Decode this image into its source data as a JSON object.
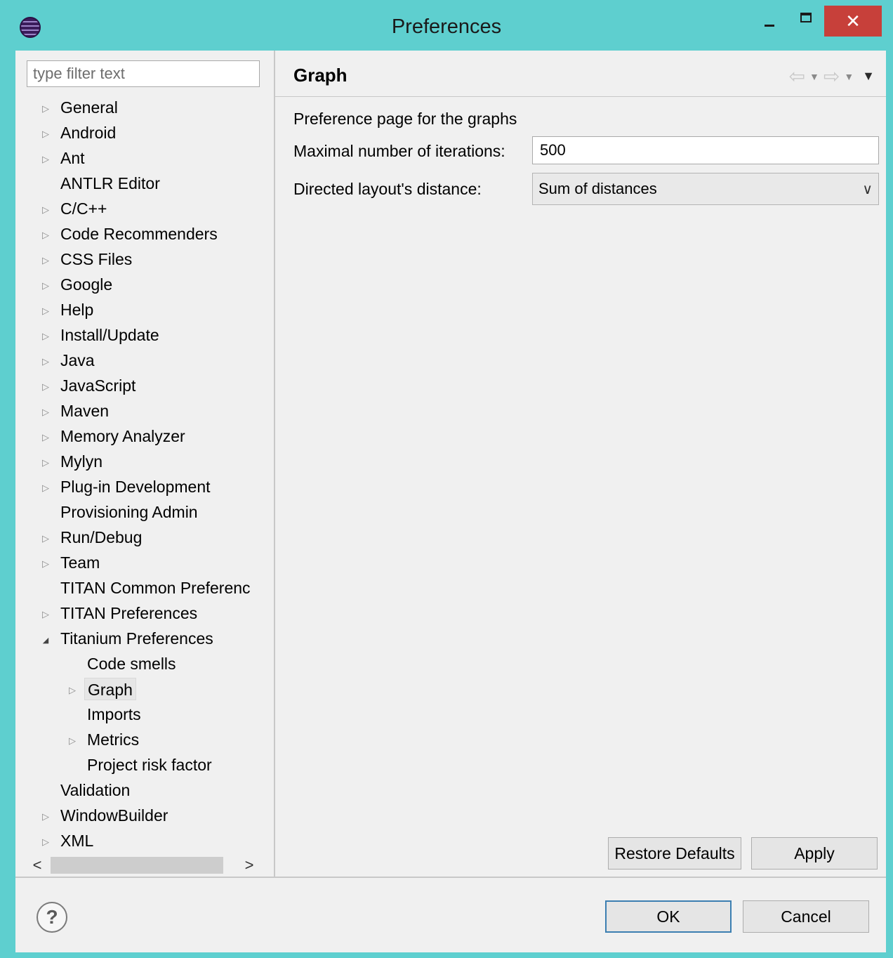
{
  "window": {
    "title": "Preferences",
    "minimize_glyph": "–",
    "maximize_glyph": "□",
    "close_glyph": "✕",
    "app_icon": "eclipse-icon"
  },
  "sidebar": {
    "filter_placeholder": "type filter text",
    "items": [
      {
        "label": "General",
        "expandable": true,
        "expanded": false,
        "level": 0
      },
      {
        "label": "Android",
        "expandable": true,
        "expanded": false,
        "level": 0
      },
      {
        "label": "Ant",
        "expandable": true,
        "expanded": false,
        "level": 0
      },
      {
        "label": "ANTLR Editor",
        "expandable": false,
        "level": 0
      },
      {
        "label": "C/C++",
        "expandable": true,
        "expanded": false,
        "level": 0
      },
      {
        "label": "Code Recommenders",
        "expandable": true,
        "expanded": false,
        "level": 0
      },
      {
        "label": "CSS Files",
        "expandable": true,
        "expanded": false,
        "level": 0
      },
      {
        "label": "Google",
        "expandable": true,
        "expanded": false,
        "level": 0
      },
      {
        "label": "Help",
        "expandable": true,
        "expanded": false,
        "level": 0
      },
      {
        "label": "Install/Update",
        "expandable": true,
        "expanded": false,
        "level": 0
      },
      {
        "label": "Java",
        "expandable": true,
        "expanded": false,
        "level": 0
      },
      {
        "label": "JavaScript",
        "expandable": true,
        "expanded": false,
        "level": 0
      },
      {
        "label": "Maven",
        "expandable": true,
        "expanded": false,
        "level": 0
      },
      {
        "label": "Memory Analyzer",
        "expandable": true,
        "expanded": false,
        "level": 0
      },
      {
        "label": "Mylyn",
        "expandable": true,
        "expanded": false,
        "level": 0
      },
      {
        "label": "Plug-in Development",
        "expandable": true,
        "expanded": false,
        "level": 0
      },
      {
        "label": "Provisioning Admin",
        "expandable": false,
        "level": 0
      },
      {
        "label": "Run/Debug",
        "expandable": true,
        "expanded": false,
        "level": 0
      },
      {
        "label": "Team",
        "expandable": true,
        "expanded": false,
        "level": 0
      },
      {
        "label": "TITAN Common Preferenc",
        "expandable": false,
        "level": 0
      },
      {
        "label": "TITAN Preferences",
        "expandable": true,
        "expanded": false,
        "level": 0
      },
      {
        "label": "Titanium Preferences",
        "expandable": true,
        "expanded": true,
        "level": 0
      },
      {
        "label": "Code smells",
        "expandable": false,
        "level": 1
      },
      {
        "label": "Graph",
        "expandable": true,
        "expanded": false,
        "level": 1,
        "selected": true
      },
      {
        "label": "Imports",
        "expandable": false,
        "level": 1
      },
      {
        "label": "Metrics",
        "expandable": true,
        "expanded": false,
        "level": 1
      },
      {
        "label": "Project risk factor",
        "expandable": false,
        "level": 1
      },
      {
        "label": "Validation",
        "expandable": false,
        "level": 0
      },
      {
        "label": "WindowBuilder",
        "expandable": true,
        "expanded": false,
        "level": 0
      },
      {
        "label": "XML",
        "expandable": true,
        "expanded": false,
        "level": 0
      }
    ],
    "scroll_left_glyph": "<",
    "scroll_right_glyph": ">"
  },
  "page": {
    "title": "Graph",
    "description": "Preference page for the graphs",
    "iterations_label": "Maximal number of iterations:",
    "iterations_value": "500",
    "distance_label": "Directed layout's distance:",
    "distance_value": "Sum of distances",
    "restore_defaults_label": "Restore Defaults",
    "apply_label": "Apply"
  },
  "footer": {
    "help_glyph": "?",
    "ok_label": "OK",
    "cancel_label": "Cancel"
  },
  "colors": {
    "title_bar": "#5ecfcf",
    "close_button": "#c7403a",
    "dialog_background": "#f0f0f0",
    "default_button_border": "#3c7fb1"
  }
}
